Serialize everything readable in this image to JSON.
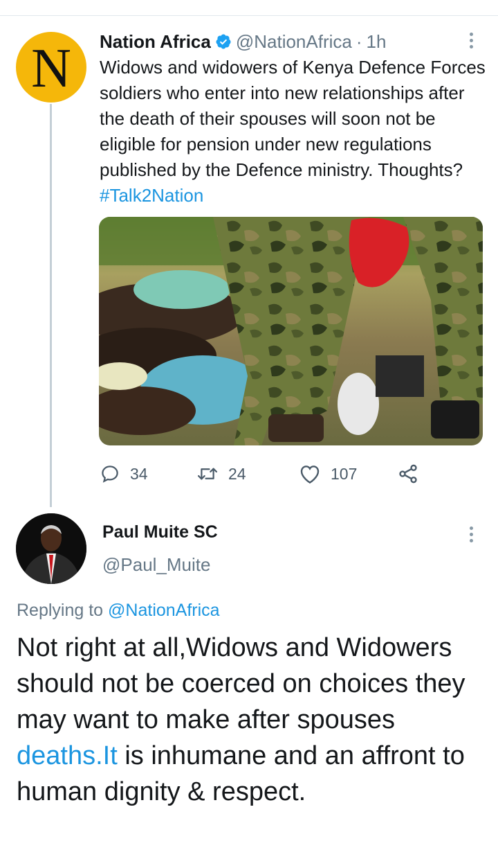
{
  "tweet1": {
    "avatar_letter": "N",
    "name": "Nation Africa",
    "verified_icon": "verified-badge-icon",
    "handle": "@NationAfrica",
    "separator": "·",
    "time": "1h",
    "text": "Widows and widowers of Kenya Defence Forces soldiers who enter into new relationships after the death of their spouses will soon not be eligible for pension under new regulations published by the Defence ministry. Thoughts?",
    "hashtag": "#Talk2Nation",
    "media_description": "photo-soldiers-in-camouflage",
    "actions": {
      "reply_count": "34",
      "retweet_count": "24",
      "like_count": "107"
    }
  },
  "tweet2": {
    "name": "Paul Muite SC",
    "handle": "@Paul_Muite",
    "replying_prefix": "Replying to",
    "replying_mention": "@NationAfrica",
    "text_part1": "Not right at all,Widows and Widowers should not be coerced on choices they may want to make after spouses ",
    "text_link": "deaths.It",
    "text_part2": " is inhumane and an affront to human dignity & respect."
  },
  "colors": {
    "accent": "#1b95e0",
    "text": "#14171a",
    "secondary": "#657786",
    "avatar_bg": "#f5b70a"
  }
}
